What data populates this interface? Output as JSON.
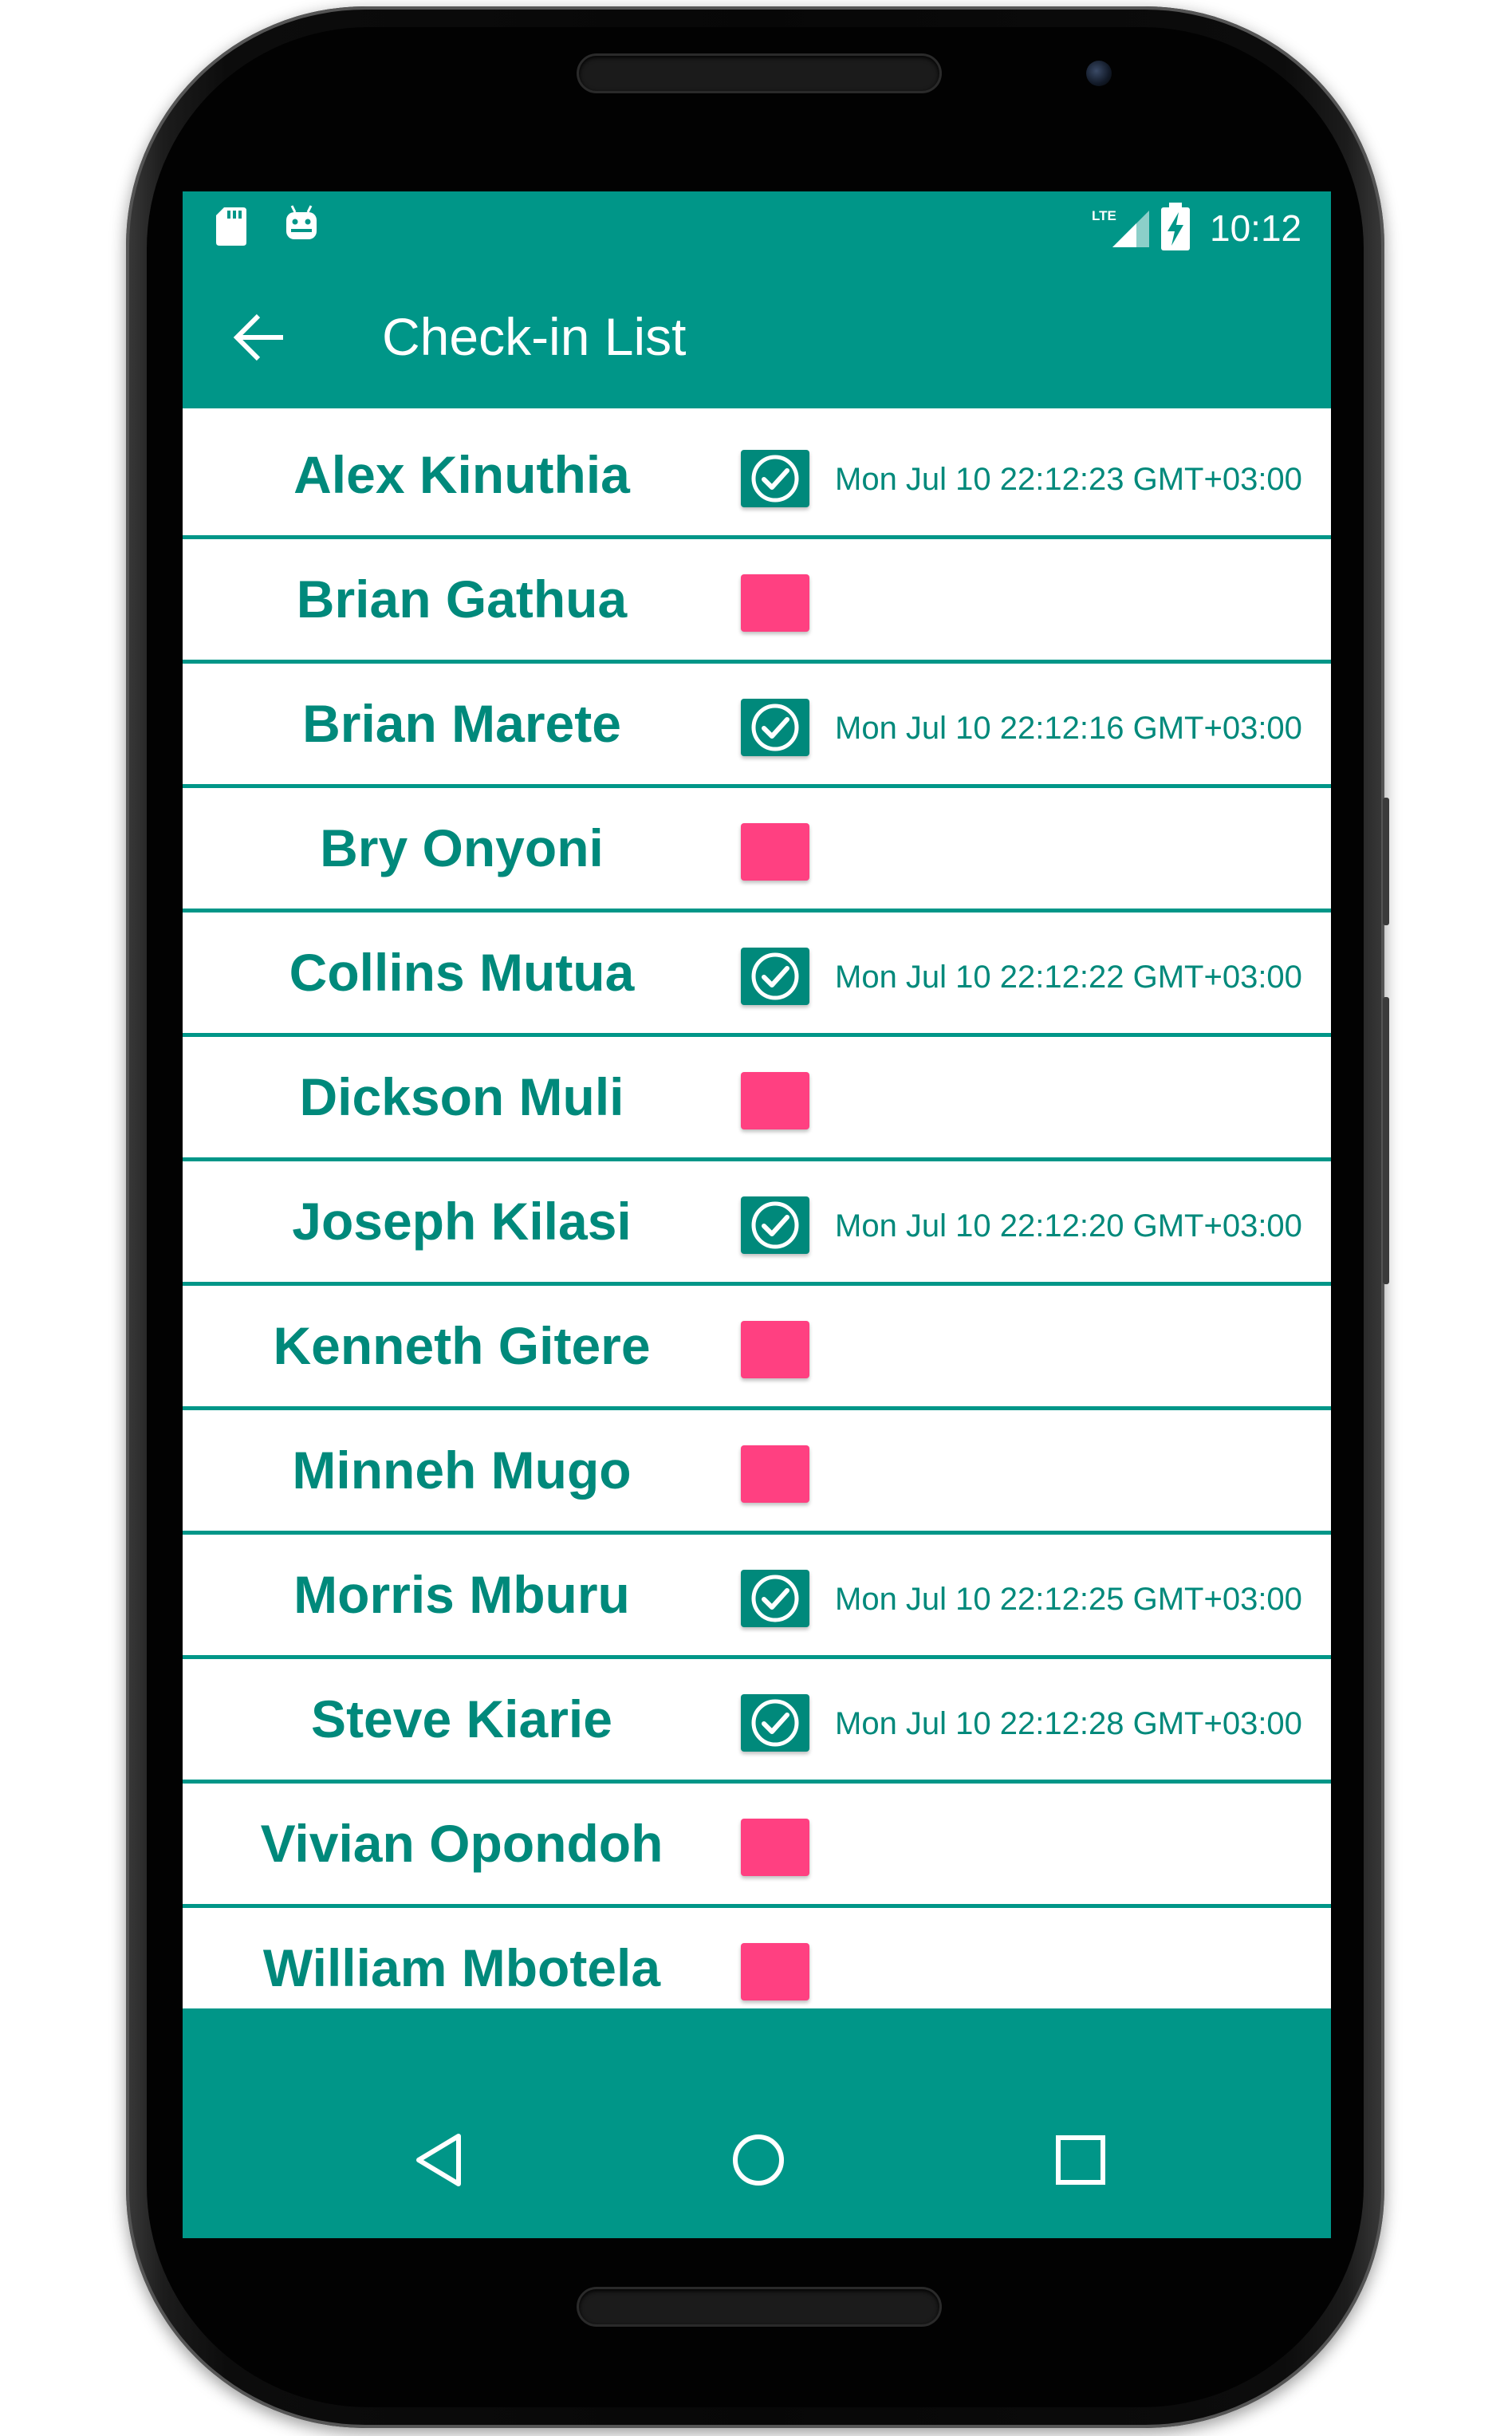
{
  "status_bar": {
    "time": "10:12",
    "network": "LTE",
    "icons": [
      "sd-card-icon",
      "android-debug-icon",
      "lte-signal-icon",
      "battery-charging-icon"
    ]
  },
  "app_bar": {
    "title": "Check-in List",
    "back_icon": "arrow-left-icon"
  },
  "colors": {
    "primary": "#009688",
    "name_text": "#00897b",
    "accent_unchecked": "#ff4081"
  },
  "attendees": [
    {
      "name": "Alex Kinuthia",
      "checked": true,
      "time": "Mon Jul 10 22:12:23 GMT+03:00"
    },
    {
      "name": "Brian Gathua",
      "checked": false,
      "time": ""
    },
    {
      "name": "Brian Marete",
      "checked": true,
      "time": "Mon Jul 10 22:12:16 GMT+03:00"
    },
    {
      "name": "Bry Onyoni",
      "checked": false,
      "time": ""
    },
    {
      "name": "Collins Mutua",
      "checked": true,
      "time": "Mon Jul 10 22:12:22 GMT+03:00"
    },
    {
      "name": "Dickson Muli",
      "checked": false,
      "time": ""
    },
    {
      "name": "Joseph Kilasi",
      "checked": true,
      "time": "Mon Jul 10 22:12:20 GMT+03:00"
    },
    {
      "name": "Kenneth Gitere",
      "checked": false,
      "time": ""
    },
    {
      "name": "Minneh Mugo",
      "checked": false,
      "time": ""
    },
    {
      "name": "Morris Mburu",
      "checked": true,
      "time": "Mon Jul 10 22:12:25 GMT+03:00"
    },
    {
      "name": "Steve Kiarie",
      "checked": true,
      "time": "Mon Jul 10 22:12:28 GMT+03:00"
    },
    {
      "name": "Vivian Opondoh",
      "checked": false,
      "time": ""
    },
    {
      "name": "William Mbotela",
      "checked": false,
      "time": ""
    }
  ],
  "nav_bar": {
    "buttons": [
      "triangle-back-icon",
      "circle-home-icon",
      "square-recents-icon"
    ]
  }
}
